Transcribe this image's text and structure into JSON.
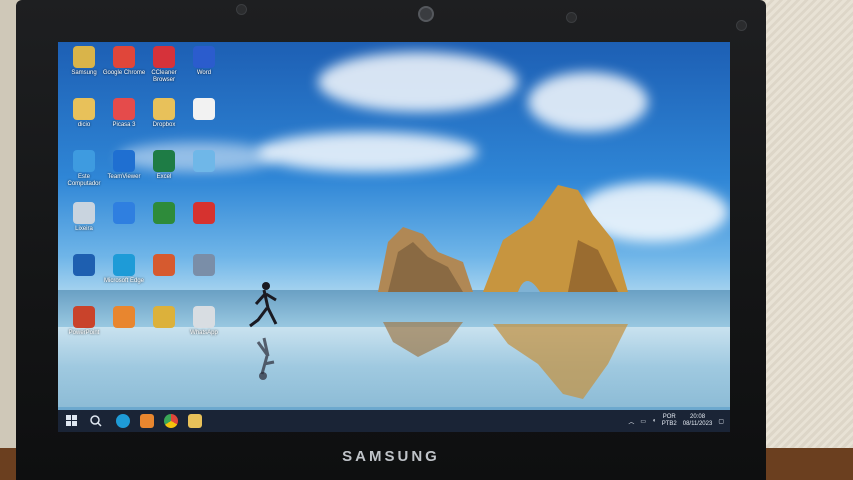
{
  "brand": "SAMSUNG",
  "desktop_icons": [
    {
      "label": "Samsung",
      "icon": "samsung-folder-icon",
      "color": "#d9b44a"
    },
    {
      "label": "Google Chrome",
      "icon": "chrome-icon",
      "color": "#e0463a"
    },
    {
      "label": "CCleaner Browser",
      "icon": "ccleaner-icon",
      "color": "#d6323a"
    },
    {
      "label": "Word",
      "icon": "word-icon",
      "color": "#2b5ccd"
    },
    {
      "label": "dicio",
      "icon": "folder-icon",
      "color": "#e8c15a"
    },
    {
      "label": "Picasa 3",
      "icon": "picasa-icon",
      "color": "#e54b4b"
    },
    {
      "label": "Dropbox",
      "icon": "folder-icon",
      "color": "#e8c15a"
    },
    {
      "label": "",
      "icon": "file-icon",
      "color": "#f2f2f2"
    },
    {
      "label": "Este Computador",
      "icon": "computer-icon",
      "color": "#3e9be0"
    },
    {
      "label": "TeamViewer",
      "icon": "teamviewer-icon",
      "color": "#1f6fd1"
    },
    {
      "label": "Excel",
      "icon": "excel-icon",
      "color": "#1e7c45"
    },
    {
      "label": "",
      "icon": "shortcut-icon",
      "color": "#6fb7e8"
    },
    {
      "label": "Lixeira",
      "icon": "recycle-bin-icon",
      "color": "#c9d4df"
    },
    {
      "label": "",
      "icon": "download-icon",
      "color": "#2f7fe0"
    },
    {
      "label": "",
      "icon": "downloader-icon",
      "color": "#2e8b3a"
    },
    {
      "label": "",
      "icon": "app-icon",
      "color": "#d6322f"
    },
    {
      "label": "",
      "icon": "app-icon",
      "color": "#1e5fb0"
    },
    {
      "label": "Microsoft Edge",
      "icon": "edge-icon",
      "color": "#1e9bd7"
    },
    {
      "label": "",
      "icon": "app-icon",
      "color": "#d65a2f"
    },
    {
      "label": "",
      "icon": "app-icon",
      "color": "#7a8ea8"
    },
    {
      "label": "PowerPoint",
      "icon": "powerpoint-icon",
      "color": "#c9432b"
    },
    {
      "label": "",
      "icon": "app-icon",
      "color": "#e8862f"
    },
    {
      "label": "",
      "icon": "app-icon",
      "color": "#dcb13b"
    },
    {
      "label": "WhatsApp",
      "icon": "whatsapp-icon",
      "color": "#d8dde2"
    }
  ],
  "taskbar": {
    "items": [
      "start-icon",
      "search-icon",
      "edge-icon",
      "app-icon",
      "chrome-icon",
      "folder-icon"
    ],
    "tray": {
      "lang": "POR",
      "layout": "PTB2",
      "time": "20:08",
      "date": "08/11/2023"
    }
  }
}
